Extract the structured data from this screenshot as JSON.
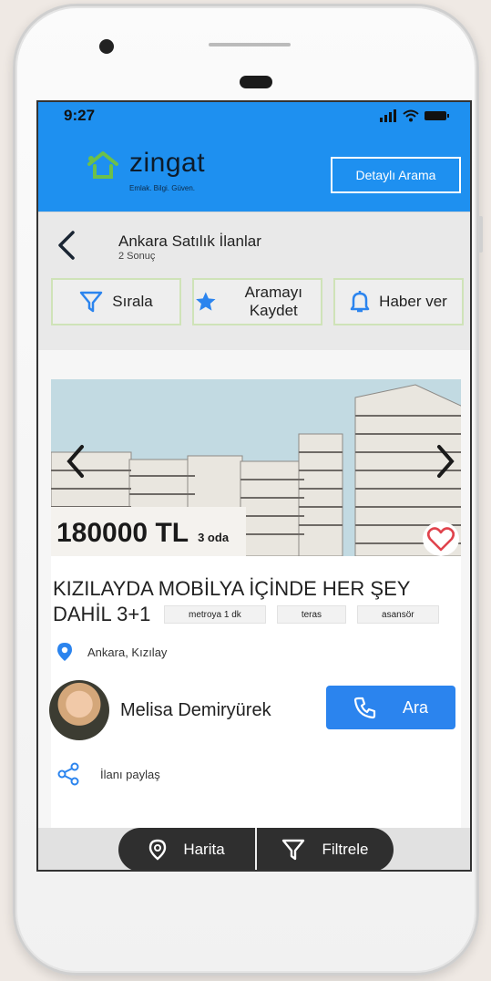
{
  "status": {
    "time": "9:27"
  },
  "header": {
    "logo_text": "zingat",
    "logo_tagline": "Emlak. Bilgi. Güven.",
    "detail_search_label": "Detaylı Arama"
  },
  "subheader": {
    "title": "Ankara Satılık İlanlar",
    "result_count": "2 Sonuç",
    "actions": [
      {
        "label": "Sırala",
        "icon": "filter-icon"
      },
      {
        "label": "Aramayı Kaydet",
        "icon": "star-icon"
      },
      {
        "label": "Haber ver",
        "icon": "bell-icon"
      }
    ]
  },
  "listing": {
    "price": "180000 TL",
    "rooms": "3 oda",
    "title": "KIZILAYDA MOBİLYA İÇİNDE HER ŞEY DAHİL 3+1",
    "tags": [
      "metroya 1 dk",
      "teras",
      "asansör"
    ],
    "location": "Ankara, Kızılay",
    "agent_name": "Melisa Demiryürek",
    "call_label": "Ara",
    "share_label": "İlanı paylaş"
  },
  "bottom_bar": {
    "map_label": "Harita",
    "filter_label": "Filtrele"
  },
  "colors": {
    "primary": "#1e90f0",
    "call_button": "#2b84ee",
    "logo_green": "#6cc04a",
    "favorite_red": "#e0434c"
  }
}
